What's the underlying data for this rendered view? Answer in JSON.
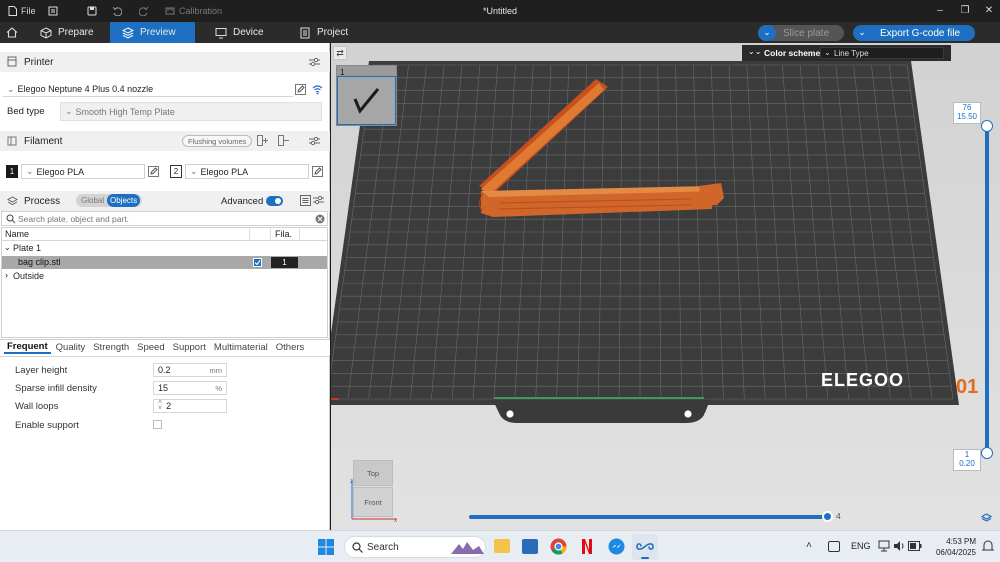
{
  "titlebar": {
    "file_label": "File",
    "calibration_label": "Calibration",
    "window_title": "*Untitled"
  },
  "nav": {
    "tabs": [
      {
        "label": "Prepare"
      },
      {
        "label": "Preview"
      },
      {
        "label": "Device"
      },
      {
        "label": "Project"
      }
    ],
    "slice_label": "Slice plate",
    "export_label": "Export G-code file"
  },
  "printer": {
    "section_label": "Printer",
    "printer_name": "Elegoo Neptune 4 Plus 0.4 nozzle",
    "bed_type_label": "Bed type",
    "bed_type_value": "Smooth High Temp Plate"
  },
  "filament": {
    "section_label": "Filament",
    "flushing_label": "Flushing volumes",
    "slots": [
      {
        "number": "1",
        "name": "Elegoo PLA",
        "color": "#1a1a1a"
      },
      {
        "number": "2",
        "name": "Elegoo PLA",
        "color": "#ffffff"
      }
    ]
  },
  "process": {
    "section_label": "Process",
    "global_label": "Global",
    "objects_label": "Objects",
    "advanced_label": "Advanced",
    "search_placeholder": "Search plate, object and part."
  },
  "objects_table": {
    "col_name": "Name",
    "col_fila": "Fila.",
    "plate_label": "Plate 1",
    "object_name": "bag clip.stl",
    "object_filament": "1",
    "outside_label": "Outside"
  },
  "settings_tabs": [
    "Frequent",
    "Quality",
    "Strength",
    "Speed",
    "Support",
    "Multimaterial",
    "Others"
  ],
  "params": {
    "layer_height": {
      "label": "Layer height",
      "value": "0.2",
      "unit": "mm"
    },
    "sparse_infill": {
      "label": "Sparse infill density",
      "value": "15",
      "unit": "%"
    },
    "wall_loops": {
      "label": "Wall loops",
      "value": "2"
    },
    "enable_support": {
      "label": "Enable support",
      "checked": false
    }
  },
  "viewport": {
    "color_scheme_label": "Color scheme",
    "line_type_label": "Line Type",
    "thumbnail_number": "1",
    "layer_top_number": "76",
    "layer_top_height": "15.50",
    "layer_bottom_number": "1",
    "layer_bottom_height": "0.20",
    "brand_text": "ELEGOO",
    "plate_number": "01",
    "move_slider_value": "4",
    "view_cube_top": "Top",
    "view_cube_front": "Front"
  },
  "taskbar": {
    "search_placeholder": "Search",
    "lang": "ENG",
    "time": "4:53 PM",
    "date": "06/04/2025"
  },
  "colors": {
    "accent": "#1e6fc1",
    "slider_blue": "#1e6fc1",
    "model_orange": "#e0782c",
    "plate_orange": "#e26a1e"
  }
}
